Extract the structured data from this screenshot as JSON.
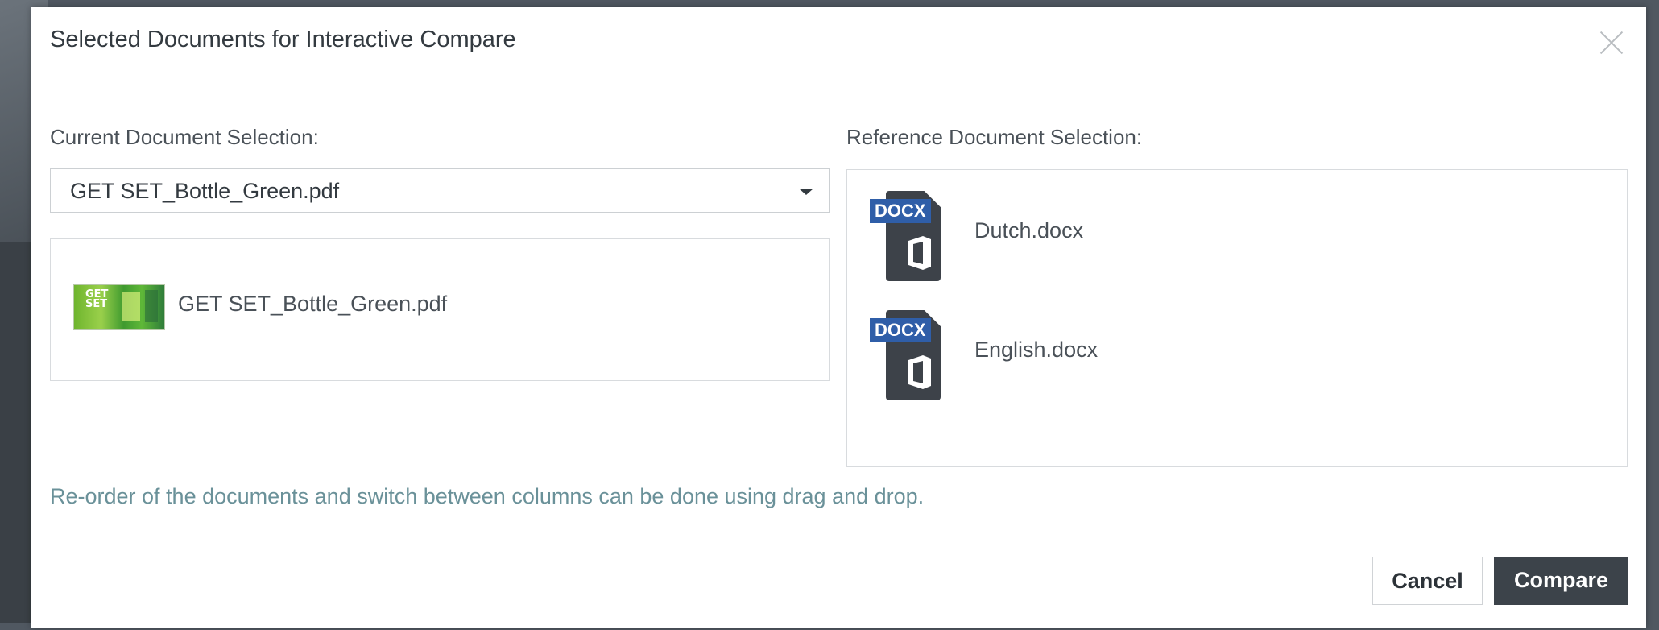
{
  "dialog": {
    "title": "Selected Documents for Interactive Compare",
    "close_icon": "close-icon"
  },
  "current": {
    "label": "Current Document Selection:",
    "select_value": "GET SET_Bottle_Green.pdf",
    "items": [
      {
        "name": "GET SET_Bottle_Green.pdf",
        "icon": "pdf-thumbnail"
      }
    ]
  },
  "reference": {
    "label": "Reference Document Selection:",
    "items": [
      {
        "name": "Dutch.docx",
        "icon": "docx-icon",
        "badge": "DOCX"
      },
      {
        "name": "English.docx",
        "icon": "docx-icon",
        "badge": "DOCX"
      }
    ]
  },
  "hint": "Re-order of the documents and switch between columns can be done using drag and drop.",
  "footer": {
    "cancel_label": "Cancel",
    "compare_label": "Compare"
  },
  "colors": {
    "accent_dark": "#3c434a",
    "docx_badge": "#2f5ea8",
    "hint_text": "#6a9199"
  }
}
